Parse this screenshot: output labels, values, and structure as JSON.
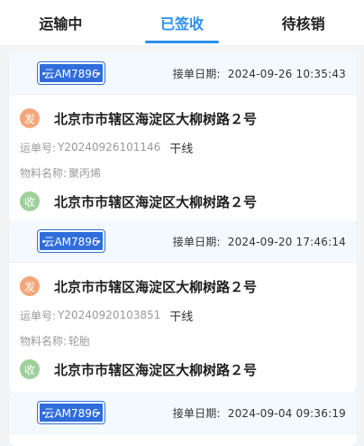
{
  "tabs": [
    {
      "label": "运输中",
      "active": false
    },
    {
      "label": "已签收",
      "active": true
    },
    {
      "label": "待核销",
      "active": false
    }
  ],
  "labels": {
    "order_date": "接单日期:",
    "waybill": "运单号:",
    "material": "物料名称:",
    "send_badge": "发",
    "recv_badge": "收"
  },
  "cards": [
    {
      "plate": "云AM7896",
      "order_date": "2024-09-26 10:35:43",
      "from": "北京市市辖区海淀区大柳树路２号",
      "waybill_no": "Y20240926101146",
      "mode": "干线",
      "material": "聚丙烯",
      "to": "北京市市辖区海淀区大柳树路２号"
    },
    {
      "plate": "云AM7896",
      "order_date": "2024-09-20 17:46:14",
      "from": "北京市市辖区海淀区大柳树路２号",
      "waybill_no": "Y20240920103851",
      "mode": "干线",
      "material": "轮胎",
      "to": "北京市市辖区海淀区大柳树路２号"
    },
    {
      "plate": "云AM7896",
      "order_date": "2024-09-04 09:36:19"
    }
  ],
  "colors": {
    "accent": "#2b8ff0",
    "plate": "#2f6ddb",
    "send_badge": "#f4a77a",
    "recv_badge": "#9ed09a"
  }
}
